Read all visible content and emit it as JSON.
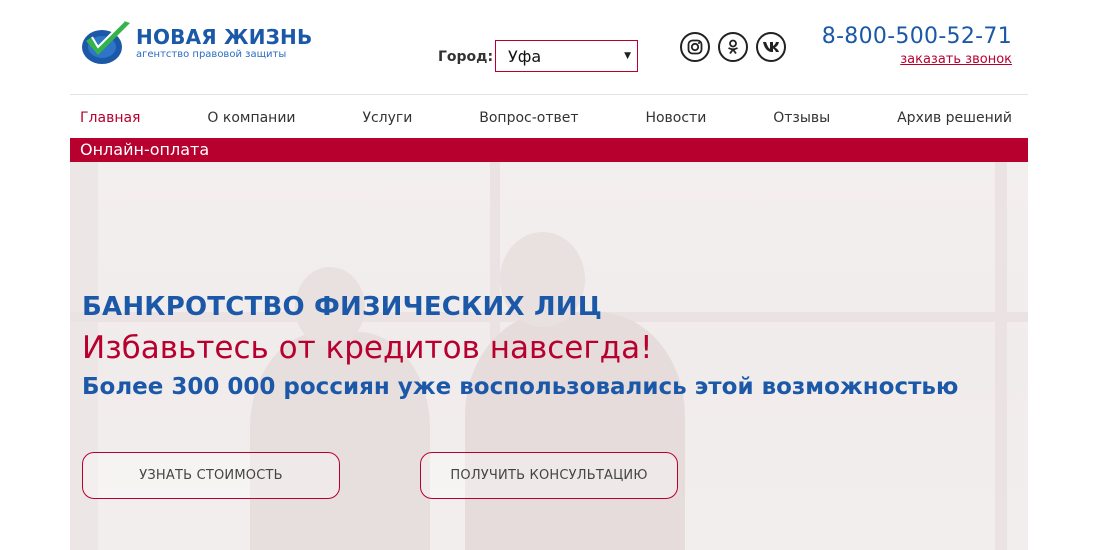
{
  "header": {
    "logo_title": "НОВАЯ ЖИЗНЬ",
    "logo_subtitle": "агентство правовой защиты",
    "city_label": "Город:",
    "city_value": "Уфа",
    "phone": "8-800-500-52-71",
    "callback_label": "заказать звонок",
    "socials": [
      "instagram-icon",
      "odnoklassniki-icon",
      "vk-icon"
    ]
  },
  "nav": {
    "items": [
      {
        "label": "Главная"
      },
      {
        "label": "О компании"
      },
      {
        "label": "Услуги"
      },
      {
        "label": "Вопрос-ответ"
      },
      {
        "label": "Новости"
      },
      {
        "label": "Отзывы"
      },
      {
        "label": "Архив решений"
      }
    ],
    "active_index": 0,
    "pay_label": "Онлайн-оплата"
  },
  "hero": {
    "title": "БАНКРОТСТВО ФИЗИЧЕСКИХ ЛИЦ",
    "subtitle": "Избавьтесь от кредитов навсегда!",
    "line": "Более 300 000 россиян уже воспользовались этой возможностью",
    "buttons": [
      {
        "label": "УЗНАТЬ СТОИМОСТЬ"
      },
      {
        "label": "ПОЛУЧИТЬ КОНСУЛЬТАЦИЮ"
      }
    ]
  },
  "colors": {
    "brand_blue": "#1b58a8",
    "brand_red": "#b8002f",
    "logo_green": "#35b34a"
  }
}
